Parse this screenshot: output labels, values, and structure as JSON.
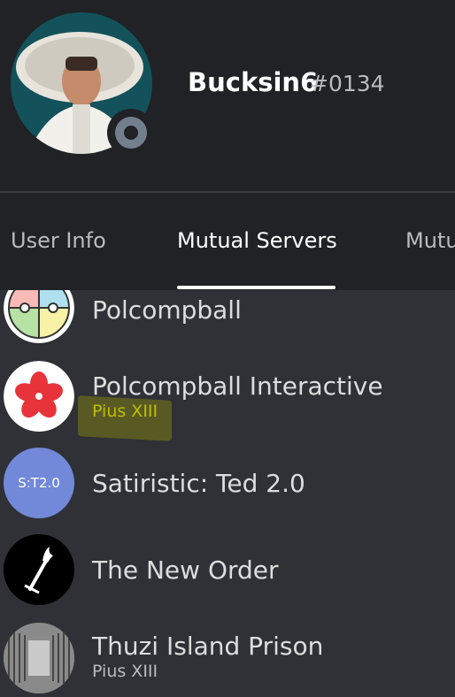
{
  "profile": {
    "username": "Bucksin6",
    "discriminator": "#0134",
    "status": "offline",
    "status_color": "#747f8d"
  },
  "tabs": [
    {
      "label": "User Info"
    },
    {
      "label": "Mutual Servers"
    },
    {
      "label": "Mutu"
    }
  ],
  "servers": [
    {
      "name": "Polcompball",
      "nickname": "",
      "icon": "polcompball-compass-icon"
    },
    {
      "name": "Polcompball Interactive",
      "nickname": "Pius XIII",
      "icon": "red-flower-icon"
    },
    {
      "name": "Satiristic: Ted 2.0",
      "nickname": "",
      "icon_text": "S:T2.0",
      "icon_color": "#7289da"
    },
    {
      "name": "The New Order",
      "nickname": "",
      "icon": "torch-icon"
    },
    {
      "name": "Thuzi Island Prison",
      "nickname": "Pius XIII",
      "icon": "prison-corridor-icon"
    }
  ]
}
